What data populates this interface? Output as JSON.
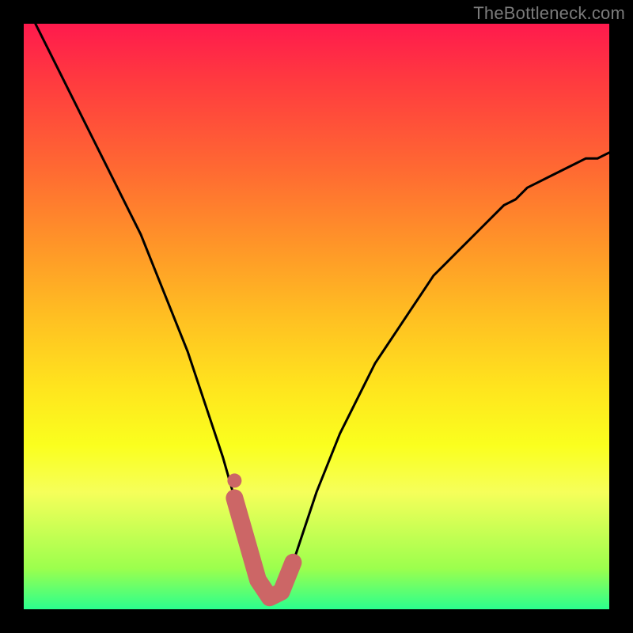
{
  "watermark": "TheBottleneck.com",
  "chart_data": {
    "type": "line",
    "title": "",
    "xlabel": "",
    "ylabel": "",
    "xlim": [
      0,
      100
    ],
    "ylim": [
      0,
      100
    ],
    "series": [
      {
        "name": "bottleneck-curve",
        "x": [
          2,
          4,
          6,
          8,
          10,
          12,
          14,
          16,
          18,
          20,
          22,
          24,
          26,
          28,
          30,
          32,
          34,
          36,
          38,
          40,
          42,
          44,
          46,
          48,
          50,
          52,
          54,
          56,
          58,
          60,
          62,
          64,
          66,
          68,
          70,
          72,
          74,
          76,
          78,
          80,
          82,
          84,
          86,
          88,
          90,
          92,
          94,
          96,
          98,
          100
        ],
        "values": [
          100,
          96,
          92,
          88,
          84,
          80,
          76,
          72,
          68,
          64,
          59,
          54,
          49,
          44,
          38,
          32,
          26,
          19,
          12,
          5,
          2,
          3,
          8,
          14,
          20,
          25,
          30,
          34,
          38,
          42,
          45,
          48,
          51,
          54,
          57,
          59,
          61,
          63,
          65,
          67,
          69,
          70,
          72,
          73,
          74,
          75,
          76,
          77,
          77,
          78
        ]
      }
    ],
    "highlight": {
      "name": "optimal-range",
      "x_start": 36,
      "x_end": 47,
      "approx_value": 2
    },
    "background_gradient": {
      "top": "#ff1a4d",
      "mid": "#ffe41e",
      "bottom": "#2bff8e",
      "meaning": "red=high bottleneck, green=low bottleneck"
    }
  }
}
